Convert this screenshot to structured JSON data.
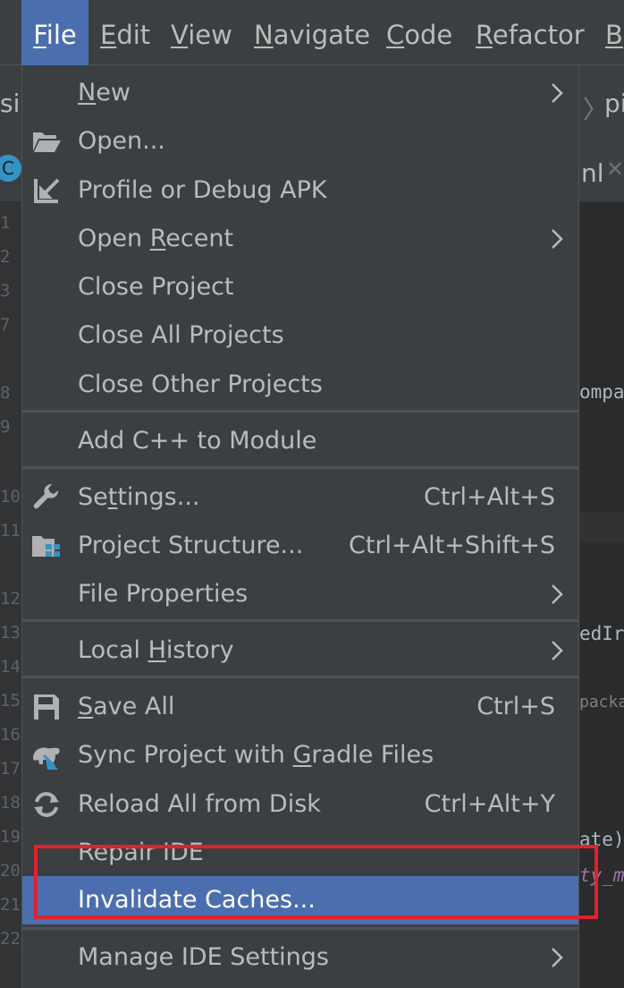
{
  "menubar": {
    "items": [
      {
        "pre": "",
        "u": "F",
        "post": "ile"
      },
      {
        "pre": "",
        "u": "E",
        "post": "dit"
      },
      {
        "pre": "",
        "u": "V",
        "post": "iew"
      },
      {
        "pre": "",
        "u": "N",
        "post": "avigate"
      },
      {
        "pre": "",
        "u": "C",
        "post": "ode"
      },
      {
        "pre": "",
        "u": "R",
        "post": "efactor"
      },
      {
        "pre": "",
        "u": "B",
        "post": ""
      }
    ]
  },
  "background": {
    "crumb_left": "si",
    "crumb_right": "pi",
    "tab_fragment": "nl",
    "tab_close": "✕",
    "tab_icon_letter": "C",
    "line_numbers": [
      "1",
      "2",
      "3",
      "7",
      "8",
      "9",
      "10",
      "11",
      "12",
      "13",
      "14",
      "15",
      "16",
      "17",
      "18",
      "19",
      "20",
      "21",
      "22"
    ],
    "code_fragments": [
      "ompa",
      "edIr",
      "packa",
      "ate)",
      "ty_m"
    ]
  },
  "file_menu": {
    "items": [
      {
        "pre": "",
        "u": "N",
        "post": "ew",
        "shortcut": "",
        "icon": ""
      },
      {
        "pre": "Open...",
        "u": "",
        "post": "",
        "shortcut": "",
        "icon": "folder-icon"
      },
      {
        "pre": "Profile or Debug APK",
        "u": "",
        "post": "",
        "shortcut": "",
        "icon": "import-arrow-icon"
      },
      {
        "pre": "Open ",
        "u": "R",
        "post": "ecent",
        "shortcut": "",
        "icon": ""
      },
      {
        "pre": "Close Project",
        "u": "",
        "post": "",
        "shortcut": "",
        "icon": ""
      },
      {
        "pre": "Close All Projects",
        "u": "",
        "post": "",
        "shortcut": "",
        "icon": ""
      },
      {
        "pre": "Close Other Projects",
        "u": "",
        "post": "",
        "shortcut": "",
        "icon": ""
      },
      {
        "pre": "Add C++ to Module",
        "u": "",
        "post": "",
        "shortcut": "",
        "icon": ""
      },
      {
        "pre": "Se",
        "u": "t",
        "post": "tings...",
        "shortcut": "Ctrl+Alt+S",
        "icon": "wrench-icon"
      },
      {
        "pre": "Project Structure...",
        "u": "",
        "post": "",
        "shortcut": "Ctrl+Alt+Shift+S",
        "icon": "project-structure-icon"
      },
      {
        "pre": "File Properties",
        "u": "",
        "post": "",
        "shortcut": "",
        "icon": ""
      },
      {
        "pre": "Local ",
        "u": "H",
        "post": "istory",
        "shortcut": "",
        "icon": ""
      },
      {
        "pre": "",
        "u": "S",
        "post": "ave All",
        "shortcut": "Ctrl+S",
        "icon": "save-icon"
      },
      {
        "pre": "Sync Project with ",
        "u": "G",
        "post": "radle Files",
        "shortcut": "",
        "icon": "gradle-sync-icon"
      },
      {
        "pre": "Reload All from Disk",
        "u": "",
        "post": "",
        "shortcut": "Ctrl+Alt+Y",
        "icon": "reload-icon"
      },
      {
        "pre": "Repair IDE",
        "u": "",
        "post": "",
        "shortcut": "",
        "icon": ""
      },
      {
        "pre": "Invalidate Caches...",
        "u": "",
        "post": "",
        "shortcut": "",
        "icon": ""
      },
      {
        "pre": "Manage IDE Settings",
        "u": "",
        "post": "",
        "shortcut": "",
        "icon": ""
      }
    ]
  },
  "colors": {
    "menu_bg": "#3c3f41",
    "selected_bg": "#4b6eaf",
    "highlight_box": "#e0222c"
  }
}
